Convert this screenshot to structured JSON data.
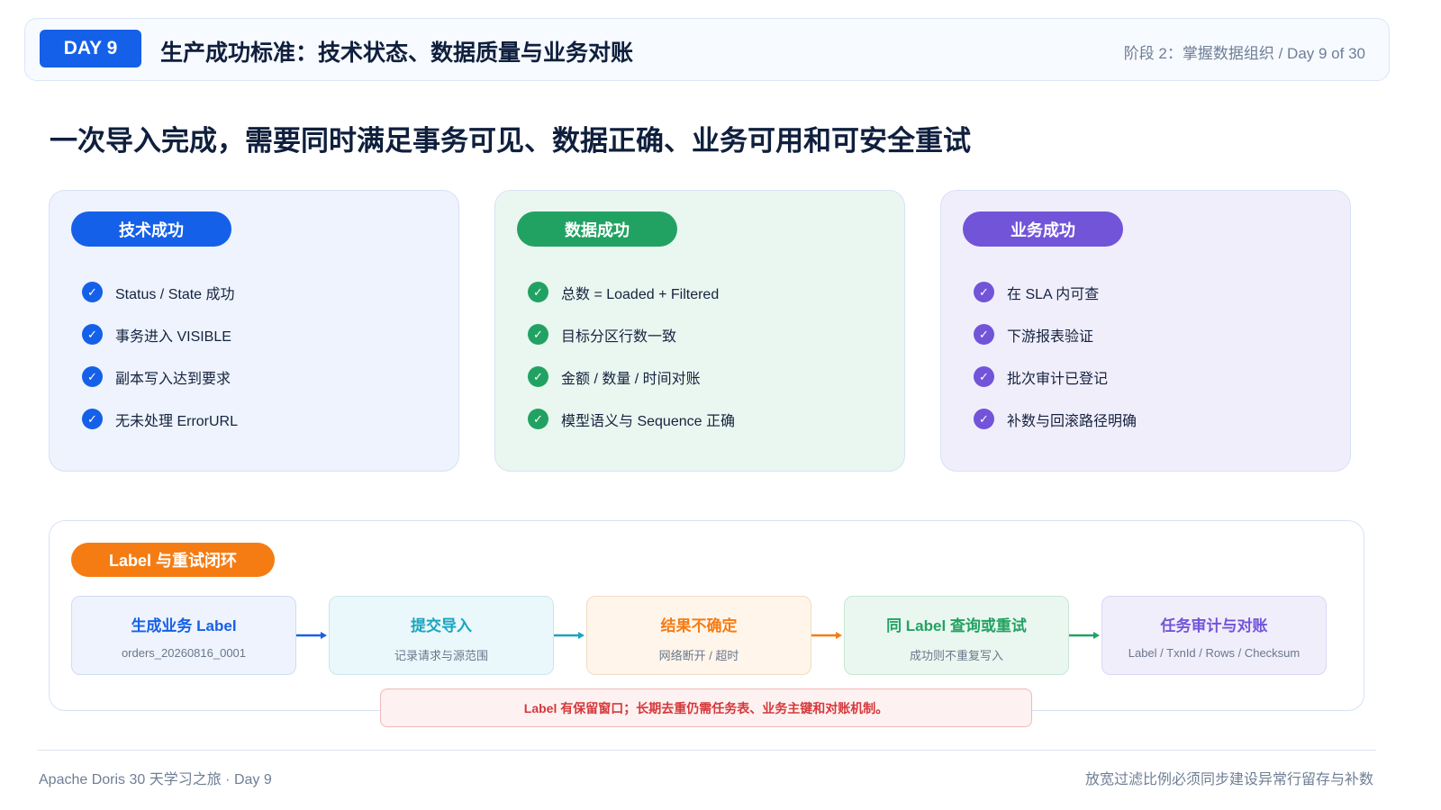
{
  "header": {
    "day_badge": "DAY 9",
    "title": "生产成功标准：技术状态、数据质量与业务对账",
    "meta": "阶段 2：掌握数据组织 / Day 9 of 30"
  },
  "headline": "一次导入完成，需要同时满足事务可见、数据正确、业务可用和可安全重试",
  "cards": {
    "tech": {
      "label": "技术成功",
      "color": "#1560e8",
      "items": [
        "Status / State 成功",
        "事务进入 VISIBLE",
        "副本写入达到要求",
        "无未处理 ErrorURL"
      ]
    },
    "data": {
      "label": "数据成功",
      "color": "#22a262",
      "items": [
        "总数 = Loaded + Filtered",
        "目标分区行数一致",
        "金额 / 数量 / 时间对账",
        "模型语义与 Sequence 正确"
      ]
    },
    "biz": {
      "label": "业务成功",
      "color": "#7254d9",
      "items": [
        "在 SLA 内可查",
        "下游报表验证",
        "批次审计已登记",
        "补数与回滚路径明确"
      ]
    }
  },
  "check_icon": "check-circle-icon",
  "flow": {
    "label": "Label 与重试闭环",
    "steps": [
      {
        "title": "生成业务 Label",
        "sub": "orders_20260816_0001",
        "color": "#1560e8"
      },
      {
        "title": "提交导入",
        "sub": "记录请求与源范围",
        "color": "#1aa4bf"
      },
      {
        "title": "结果不确定",
        "sub": "网络断开 / 超时",
        "color": "#f57c13"
      },
      {
        "title": "同 Label 查询或重试",
        "sub": "成功则不重复写入",
        "color": "#22a262"
      },
      {
        "title": "任务审计与对账",
        "sub": "Label / TxnId / Rows / Checksum",
        "color": "#7254d9"
      }
    ],
    "note": "Label 有保留窗口；长期去重仍需任务表、业务主键和对账机制。"
  },
  "footer": {
    "left": "Apache Doris 30 天学习之旅 · Day 9",
    "right": "放宽过滤比例必须同步建设异常行留存与补数"
  }
}
